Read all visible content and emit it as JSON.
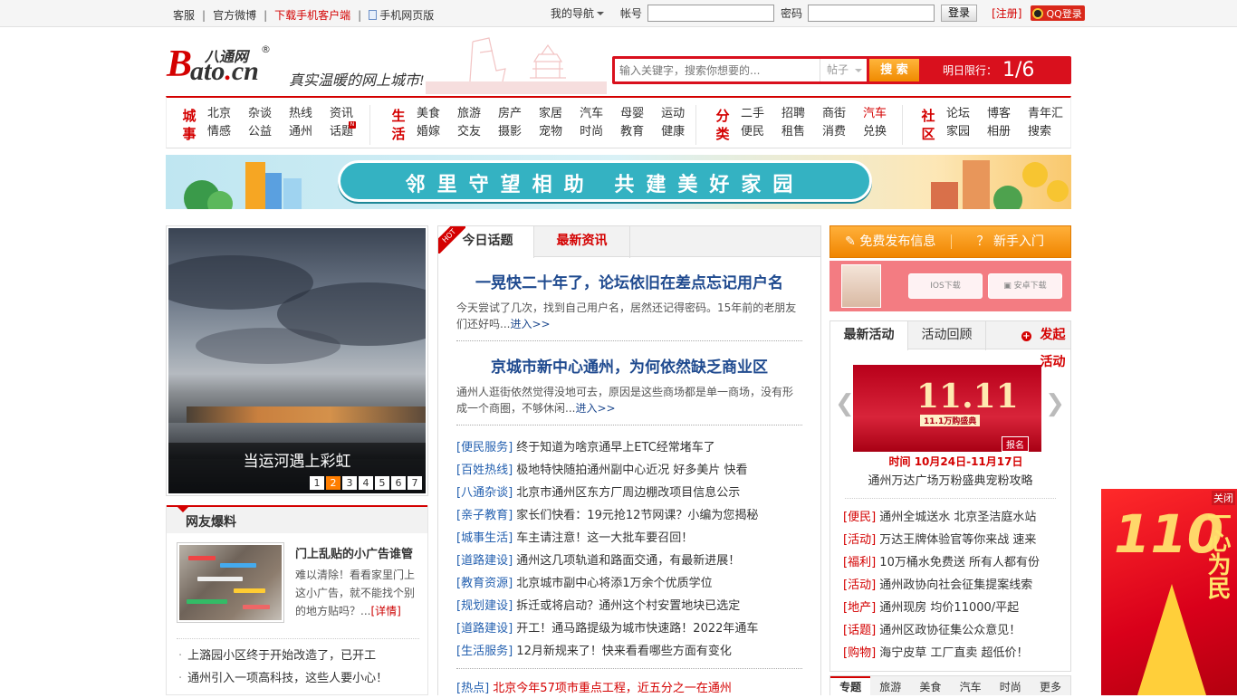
{
  "topbar": {
    "links": [
      "客服",
      "官方微博",
      "下载手机客户端",
      "手机网页版"
    ],
    "my_nav": "我的导航",
    "account_label": "帐号",
    "password_label": "密码",
    "login_btn": "登录",
    "register": "[注册]",
    "qq_login": "QQ登录"
  },
  "logo": {
    "brand_cn": "八通网",
    "reg_mark": "®",
    "b": "B",
    "ato": "ato",
    "dot": ".",
    "cn": "cn",
    "slogan": "真实温暖的网上城市!"
  },
  "search": {
    "placeholder": "输入关键字，搜索你想要的...",
    "category": "帖子",
    "button": "搜 索",
    "limit_label": "明日限行：",
    "limit_value": "1/6"
  },
  "catnav": {
    "groups": [
      {
        "head": "城事",
        "items": [
          "北京",
          "杂谈",
          "热线",
          "资讯",
          "情感",
          "公益",
          "通州",
          "话题"
        ],
        "cols": 4
      },
      {
        "head": "生活",
        "items": [
          "美食",
          "旅游",
          "房产",
          "家居",
          "汽车",
          "母婴",
          "运动",
          "婚嫁",
          "交友",
          "摄影",
          "宠物",
          "时尚",
          "教育",
          "健康"
        ],
        "cols": 7
      },
      {
        "head": "分类",
        "items": [
          "二手",
          "招聘",
          "商街",
          "汽车",
          "便民",
          "租售",
          "消费",
          "兑换"
        ],
        "cols": 4
      },
      {
        "head": "社区",
        "items": [
          "论坛",
          "博客",
          "青年汇",
          "家园",
          "相册",
          "搜索"
        ],
        "cols": 3
      }
    ]
  },
  "banner": {
    "text": "邻里守望相助 共建美好家园"
  },
  "slider": {
    "caption": "当运河遇上彩虹",
    "pages": [
      "1",
      "2",
      "3",
      "4",
      "5",
      "6",
      "7"
    ],
    "active_page": "2"
  },
  "baoliao": {
    "title": "网友爆料",
    "feature_title": "门上乱贴的小广告谁管",
    "feature_desc": "难以清除！看看家里门上这小广告，就不能找个别的地方贴吗？...",
    "feature_more": "[详情]",
    "list": [
      "上潞园小区终于开始改造了，已开工",
      "通州引入一项高科技，这些人要小心！"
    ]
  },
  "topics": {
    "tab_active": "今日话题",
    "tab_other": "最新资讯",
    "hot_badge": "HOT",
    "articles": [
      {
        "title": "一晃快二十年了，论坛依旧在差点忘记用户名",
        "summary": "今天尝试了几次，找到自己用户名，居然还记得密码。15年前的老朋友们还好吗...",
        "more": "进入>>"
      },
      {
        "title": "京城市新中心通州，为何依然缺乏商业区",
        "summary": "通州人逛街依然觉得没地可去，原因是这些商场都是单一商场，没有形成一个商圈，不够休闲...",
        "more": "进入>>"
      }
    ],
    "news": [
      {
        "tag": "[便民服务]",
        "text": "终于知道为啥京通早上ETC经常堵车了"
      },
      {
        "tag": "[百姓热线]",
        "text": "极地特快随拍通州副中心近况 好多美片 快看"
      },
      {
        "tag": "[八通杂谈]",
        "text": "北京市通州区东方厂周边棚改项目信息公示"
      },
      {
        "tag": "[亲子教育]",
        "text": "家长们快看：19元抢12节网课？小编为您揭秘"
      },
      {
        "tag": "[城事生活]",
        "text": "车主请注意！这一大批车要召回！"
      },
      {
        "tag": "[道路建设]",
        "text": "通州这几项轨道和路面交通，有最新进展！"
      },
      {
        "tag": "[教育资源]",
        "text": "北京城市副中心将添1万余个优质学位"
      },
      {
        "tag": "[规划建设]",
        "text": "拆迁或将启动？通州这个村安置地块已选定"
      },
      {
        "tag": "[道路建设]",
        "text": "开工！通马路提级为城市快速路！2022年通车"
      },
      {
        "tag": "[生活服务]",
        "text": "12月新规来了！快来看看哪些方面有变化"
      }
    ],
    "hot_line": {
      "tag": "[热点]",
      "text": "北京今年57项市重点工程，近五分之一在通州"
    }
  },
  "right": {
    "publish": "免费发布信息",
    "guide": "新手入门",
    "ios": "IOS下载",
    "android": "安卓下载",
    "act_tabs": [
      "最新活动",
      "活动回顾",
      "发起活动"
    ],
    "poster_big": "11.11",
    "poster_sub": "11.1万购盛典",
    "poster_btn": "报名",
    "time": "时间 10月24日-11月17日",
    "act_name": "通州万达广场万粉盛典宠粉攻略",
    "list": [
      {
        "tag": "[便民]",
        "text": "通州全城送水 北京圣洁庭水站"
      },
      {
        "tag": "[活动]",
        "text": "万达王牌体验官等你来战 速来"
      },
      {
        "tag": "[福利]",
        "text": "10万桶水免费送 所有人都有份"
      },
      {
        "tag": "[活动]",
        "text": "通州政协向社会征集提案线索"
      },
      {
        "tag": "[地产]",
        "text": "通州现房 均价11000/平起"
      },
      {
        "tag": "[话题]",
        "text": "通州区政协征集公众意见！"
      },
      {
        "tag": "[购物]",
        "text": "海宁皮草 工厂直卖 超低价！"
      }
    ],
    "bottom_tabs": [
      "专题",
      "旅游",
      "美食",
      "汽车",
      "时尚",
      "更多"
    ]
  },
  "side_ad": {
    "close": "关闭",
    "number": "110",
    "slogan": "一心为民"
  },
  "colors": {
    "brand_red": "#d40000",
    "link_blue": "#2561b0",
    "orange": "#f08500"
  }
}
